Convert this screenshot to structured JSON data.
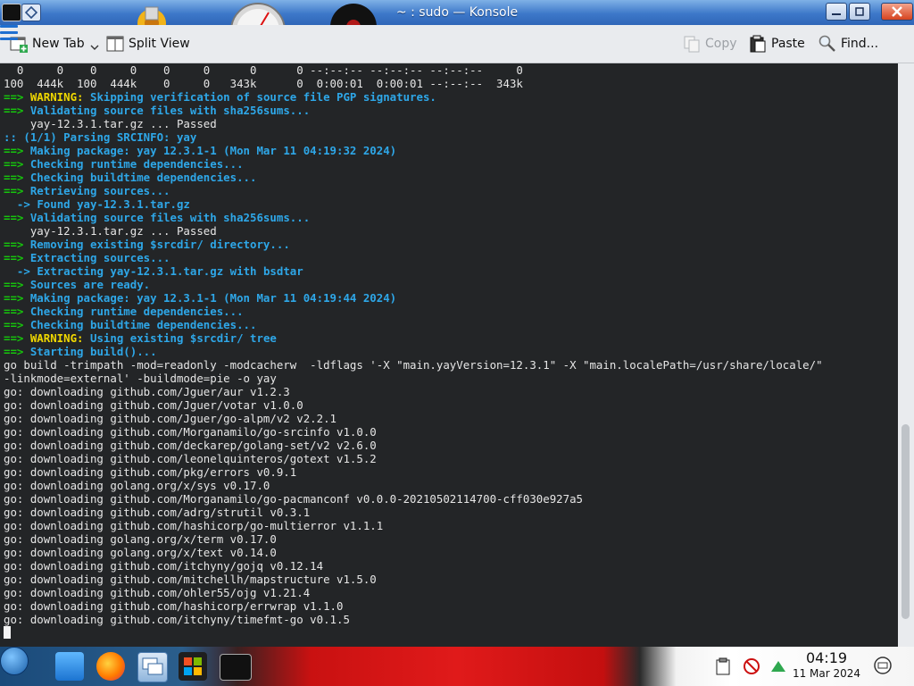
{
  "window": {
    "title": "~ : sudo — Konsole",
    "app_icon_text": "",
    "app_icon": "konsole-icon"
  },
  "toolbar": {
    "new_tab": "New Tab",
    "split_view": "Split View",
    "copy": "Copy",
    "paste": "Paste",
    "find": "Find..."
  },
  "terminal": {
    "lines": [
      {
        "parts": [
          {
            "t": "  0     0    0     0    0     0      0      0 --:--:-- --:--:-- --:--:--     0",
            "c": "plain"
          }
        ]
      },
      {
        "parts": [
          {
            "t": "100  444k  100  444k    0     0   343k      0  0:00:01  0:00:01 --:--:--  343k",
            "c": "plain"
          }
        ]
      },
      {
        "parts": [
          {
            "t": "==> ",
            "c": "arrow"
          },
          {
            "t": "WARNING: ",
            "c": "warn"
          },
          {
            "t": "Skipping verification of source file PGP signatures.",
            "c": "msg"
          }
        ]
      },
      {
        "parts": [
          {
            "t": "==> ",
            "c": "arrow"
          },
          {
            "t": "Validating source files with sha256sums...",
            "c": "msg"
          }
        ]
      },
      {
        "parts": [
          {
            "t": "    yay-12.3.1.tar.gz ... Passed",
            "c": "plain"
          }
        ]
      },
      {
        "parts": [
          {
            "t": ":: ",
            "c": "msg"
          },
          {
            "t": "(1/1) Parsing SRCINFO: yay",
            "c": "msg"
          }
        ]
      },
      {
        "parts": [
          {
            "t": "==> ",
            "c": "arrow"
          },
          {
            "t": "Making package: yay 12.3.1-1 (Mon Mar 11 04:19:32 2024)",
            "c": "msg"
          }
        ]
      },
      {
        "parts": [
          {
            "t": "==> ",
            "c": "arrow"
          },
          {
            "t": "Checking runtime dependencies...",
            "c": "msg"
          }
        ]
      },
      {
        "parts": [
          {
            "t": "==> ",
            "c": "arrow"
          },
          {
            "t": "Checking buildtime dependencies...",
            "c": "msg"
          }
        ]
      },
      {
        "parts": [
          {
            "t": "==> ",
            "c": "arrow"
          },
          {
            "t": "Retrieving sources...",
            "c": "msg"
          }
        ]
      },
      {
        "parts": [
          {
            "t": "  -> ",
            "c": "sub"
          },
          {
            "t": "Found yay-12.3.1.tar.gz",
            "c": "msg"
          }
        ]
      },
      {
        "parts": [
          {
            "t": "==> ",
            "c": "arrow"
          },
          {
            "t": "Validating source files with sha256sums...",
            "c": "msg"
          }
        ]
      },
      {
        "parts": [
          {
            "t": "    yay-12.3.1.tar.gz ... Passed",
            "c": "plain"
          }
        ]
      },
      {
        "parts": [
          {
            "t": "==> ",
            "c": "arrow"
          },
          {
            "t": "Removing existing $srcdir/ directory...",
            "c": "msg"
          }
        ]
      },
      {
        "parts": [
          {
            "t": "==> ",
            "c": "arrow"
          },
          {
            "t": "Extracting sources...",
            "c": "msg"
          }
        ]
      },
      {
        "parts": [
          {
            "t": "  -> ",
            "c": "sub"
          },
          {
            "t": "Extracting yay-12.3.1.tar.gz with bsdtar",
            "c": "msg"
          }
        ]
      },
      {
        "parts": [
          {
            "t": "==> ",
            "c": "arrow"
          },
          {
            "t": "Sources are ready.",
            "c": "msg"
          }
        ]
      },
      {
        "parts": [
          {
            "t": "==> ",
            "c": "arrow"
          },
          {
            "t": "Making package: yay 12.3.1-1 (Mon Mar 11 04:19:44 2024)",
            "c": "msg"
          }
        ]
      },
      {
        "parts": [
          {
            "t": "==> ",
            "c": "arrow"
          },
          {
            "t": "Checking runtime dependencies...",
            "c": "msg"
          }
        ]
      },
      {
        "parts": [
          {
            "t": "==> ",
            "c": "arrow"
          },
          {
            "t": "Checking buildtime dependencies...",
            "c": "msg"
          }
        ]
      },
      {
        "parts": [
          {
            "t": "==> ",
            "c": "arrow"
          },
          {
            "t": "WARNING: ",
            "c": "warn"
          },
          {
            "t": "Using existing $srcdir/ tree",
            "c": "msg"
          }
        ]
      },
      {
        "parts": [
          {
            "t": "==> ",
            "c": "arrow"
          },
          {
            "t": "Starting build()...",
            "c": "msg"
          }
        ]
      },
      {
        "parts": [
          {
            "t": "go build -trimpath -mod=readonly -modcacherw  -ldflags '-X \"main.yayVersion=12.3.1\" -X \"main.localePath=/usr/share/locale/\"",
            "c": "plain"
          }
        ]
      },
      {
        "parts": [
          {
            "t": "-linkmode=external' -buildmode=pie -o yay",
            "c": "plain"
          }
        ]
      },
      {
        "parts": [
          {
            "t": "go: downloading github.com/Jguer/aur v1.2.3",
            "c": "plain"
          }
        ]
      },
      {
        "parts": [
          {
            "t": "go: downloading github.com/Jguer/votar v1.0.0",
            "c": "plain"
          }
        ]
      },
      {
        "parts": [
          {
            "t": "go: downloading github.com/Jguer/go-alpm/v2 v2.2.1",
            "c": "plain"
          }
        ]
      },
      {
        "parts": [
          {
            "t": "go: downloading github.com/Morganamilo/go-srcinfo v1.0.0",
            "c": "plain"
          }
        ]
      },
      {
        "parts": [
          {
            "t": "go: downloading github.com/deckarep/golang-set/v2 v2.6.0",
            "c": "plain"
          }
        ]
      },
      {
        "parts": [
          {
            "t": "go: downloading github.com/leonelquinteros/gotext v1.5.2",
            "c": "plain"
          }
        ]
      },
      {
        "parts": [
          {
            "t": "go: downloading github.com/pkg/errors v0.9.1",
            "c": "plain"
          }
        ]
      },
      {
        "parts": [
          {
            "t": "go: downloading golang.org/x/sys v0.17.0",
            "c": "plain"
          }
        ]
      },
      {
        "parts": [
          {
            "t": "go: downloading github.com/Morganamilo/go-pacmanconf v0.0.0-20210502114700-cff030e927a5",
            "c": "plain"
          }
        ]
      },
      {
        "parts": [
          {
            "t": "go: downloading github.com/adrg/strutil v0.3.1",
            "c": "plain"
          }
        ]
      },
      {
        "parts": [
          {
            "t": "go: downloading github.com/hashicorp/go-multierror v1.1.1",
            "c": "plain"
          }
        ]
      },
      {
        "parts": [
          {
            "t": "go: downloading golang.org/x/term v0.17.0",
            "c": "plain"
          }
        ]
      },
      {
        "parts": [
          {
            "t": "go: downloading golang.org/x/text v0.14.0",
            "c": "plain"
          }
        ]
      },
      {
        "parts": [
          {
            "t": "go: downloading github.com/itchyny/gojq v0.12.14",
            "c": "plain"
          }
        ]
      },
      {
        "parts": [
          {
            "t": "go: downloading github.com/mitchellh/mapstructure v1.5.0",
            "c": "plain"
          }
        ]
      },
      {
        "parts": [
          {
            "t": "go: downloading github.com/ohler55/ojg v1.21.4",
            "c": "plain"
          }
        ]
      },
      {
        "parts": [
          {
            "t": "go: downloading github.com/hashicorp/errwrap v1.1.0",
            "c": "plain"
          }
        ]
      },
      {
        "parts": [
          {
            "t": "go: downloading github.com/itchyny/timefmt-go v0.1.5",
            "c": "plain"
          }
        ]
      }
    ]
  },
  "colors": {
    "arrow": "#16c60c",
    "warning": "#f0d800",
    "message": "#2ea7e8",
    "terminal_bg": "#232527"
  },
  "taskbar": {
    "items": [
      "start-icon",
      "file-manager-icon",
      "firefox-icon",
      "network-manager-icon",
      "windows-logo-icon",
      "konsole-icon"
    ],
    "clock_time": "04:19",
    "clock_date": "11 Mar 2024"
  }
}
